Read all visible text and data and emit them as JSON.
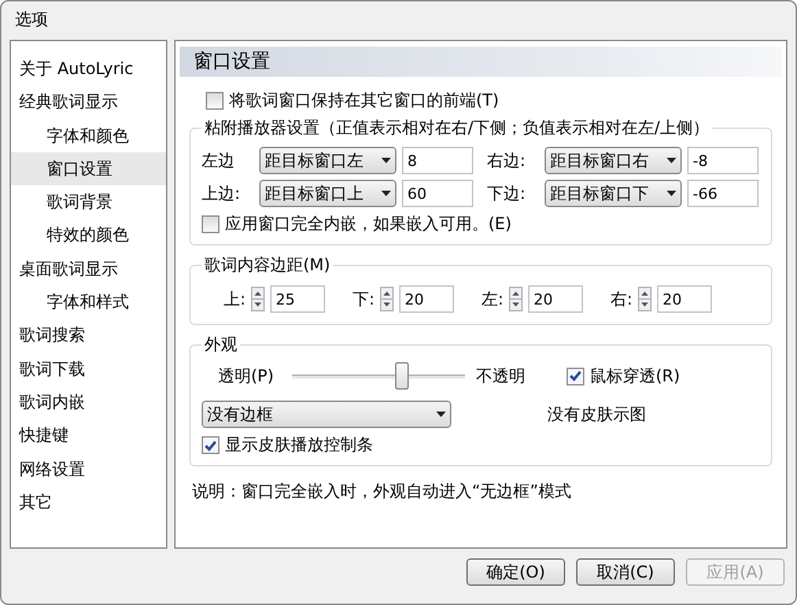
{
  "window": {
    "title": "选项"
  },
  "sidebar": {
    "items": [
      {
        "label": "关于 AutoLyric",
        "selected": false
      },
      {
        "label": "经典歌词显示",
        "selected": false,
        "children": [
          {
            "label": "字体和颜色",
            "selected": false
          },
          {
            "label": "窗口设置",
            "selected": true
          },
          {
            "label": "歌词背景",
            "selected": false
          },
          {
            "label": "特效的颜色",
            "selected": false
          }
        ]
      },
      {
        "label": "桌面歌词显示",
        "selected": false,
        "children": [
          {
            "label": "字体和样式",
            "selected": false
          }
        ]
      },
      {
        "label": "歌词搜索",
        "selected": false
      },
      {
        "label": "歌词下载",
        "selected": false
      },
      {
        "label": "歌词内嵌",
        "selected": false
      },
      {
        "label": "快捷键",
        "selected": false
      },
      {
        "label": "网络设置",
        "selected": false
      },
      {
        "label": "其它",
        "selected": false
      }
    ]
  },
  "panel": {
    "title": "窗口设置",
    "keep_on_top": {
      "label": "将歌词窗口保持在其它窗口的前端(T)",
      "checked": false
    },
    "attach": {
      "title": "粘附播放器设置（正值表示相对在右/下侧；负值表示相对在左/上侧）",
      "rows": [
        [
          {
            "label": "左边",
            "select": "距目标窗口左",
            "value": "8"
          },
          {
            "label": "右边:",
            "select": "距目标窗口右",
            "value": "-8"
          }
        ],
        [
          {
            "label": "上边:",
            "select": "距目标窗口上",
            "value": "60"
          },
          {
            "label": "下边:",
            "select": "距目标窗口下",
            "value": "-66"
          }
        ]
      ],
      "embed": {
        "label": "应用窗口完全内嵌，如果嵌入可用。(E)",
        "checked": false
      }
    },
    "margins": {
      "title": "歌词内容边距(M)",
      "fields": [
        {
          "label": "上:",
          "value": "25"
        },
        {
          "label": "下:",
          "value": "20"
        },
        {
          "label": "左:",
          "value": "20"
        },
        {
          "label": "右:",
          "value": "20"
        }
      ]
    },
    "appearance": {
      "title": "外观",
      "transparent_label": "透明(P)",
      "opaque_label": "不透明",
      "opacity": {
        "level": 0.64
      },
      "click_through": {
        "label": "鼠标穿透(R)",
        "checked": true
      },
      "border_select": "没有边框",
      "skin_preview": "没有皮肤示图",
      "show_controls": {
        "label": "显示皮肤播放控制条",
        "checked": true
      }
    },
    "note": "说明：窗口完全嵌入时，外观自动进入“无边框”模式"
  },
  "buttons": [
    {
      "label": "确定(O)",
      "disabled": false
    },
    {
      "label": "取消(C)",
      "disabled": false
    },
    {
      "label": "应用(A)",
      "disabled": true
    }
  ]
}
